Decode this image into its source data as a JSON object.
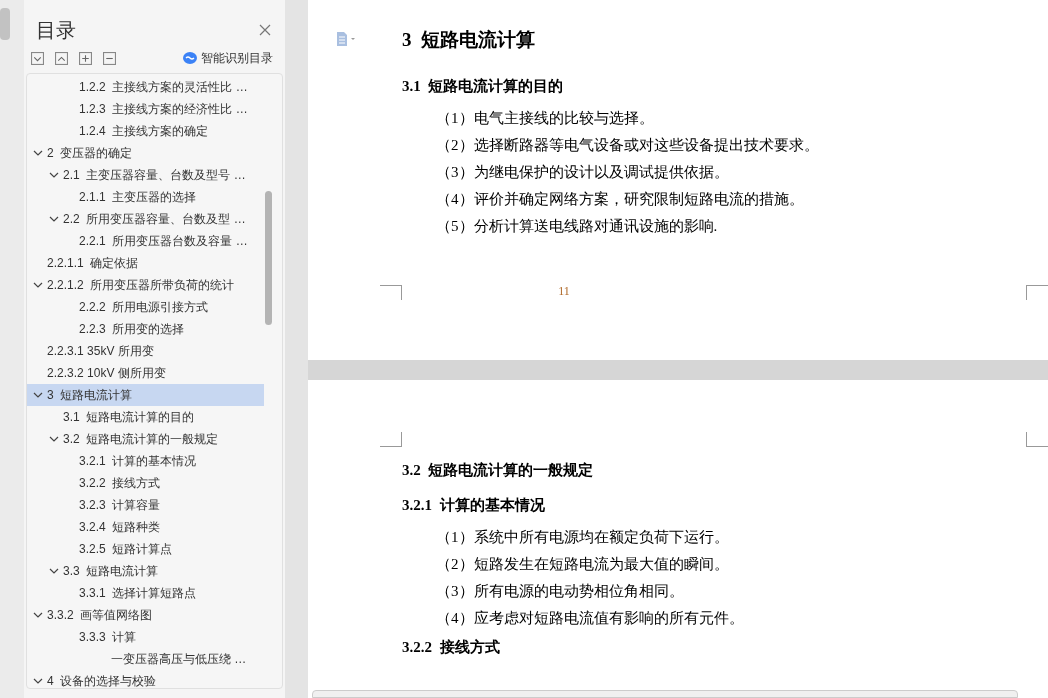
{
  "panel": {
    "title": "目录",
    "smart_button": "智能识别目录"
  },
  "toc": [
    {
      "children": [
        {
          "children": [
            {
              "label": "1.2.2  主接线方案的灵活性比 …",
              "selected": false
            },
            {
              "label": "1.2.3  主接线方案的经济性比 …",
              "selected": false
            },
            {
              "label": "1.2.4  主接线方案的确定",
              "selected": false
            }
          ]
        }
      ]
    },
    {
      "label": "2  变压器的确定",
      "expanded": true,
      "selected": false,
      "children": [
        {
          "label": "2.1  主变压器容量、台数及型号 …",
          "expanded": true,
          "selected": false,
          "children": [
            {
              "label": "2.1.1  主变压器的选择",
              "selected": false
            }
          ]
        },
        {
          "label": "2.2  所用变压器容量、台数及型 …",
          "expanded": true,
          "selected": false,
          "children": [
            {
              "label": "2.2.1  所用变压器台数及容量 …",
              "selected": false
            }
          ]
        }
      ]
    },
    {
      "label": "2.2.1.1  确定依据",
      "selected": false
    },
    {
      "label": "2.2.1.2  所用变压器所带负荷的统计",
      "expanded": true,
      "selected": false,
      "children": [
        {
          "children": [
            {
              "label": "2.2.2  所用电源引接方式",
              "selected": false
            },
            {
              "label": "2.2.3  所用变的选择",
              "selected": false
            }
          ]
        }
      ]
    },
    {
      "label": "2.2.3.1 35kV 所用变",
      "selected": false
    },
    {
      "label": "2.2.3.2 10kV 侧所用变",
      "selected": false
    },
    {
      "label": "3  短路电流计算",
      "expanded": true,
      "selected": true,
      "children": [
        {
          "label": "3.1  短路电流计算的目的",
          "selected": false
        },
        {
          "label": "3.2  短路电流计算的一般规定",
          "expanded": true,
          "selected": false,
          "children": [
            {
              "label": "3.2.1  计算的基本情况",
              "selected": false
            },
            {
              "label": "3.2.2  接线方式",
              "selected": false
            },
            {
              "label": "3.2.3  计算容量",
              "selected": false
            },
            {
              "label": "3.2.4  短路种类",
              "selected": false
            },
            {
              "label": "3.2.5  短路计算点",
              "selected": false
            }
          ]
        },
        {
          "label": "3.3  短路电流计算",
          "expanded": true,
          "selected": false,
          "children": [
            {
              "label": "3.3.1  选择计算短路点",
              "selected": false
            }
          ]
        }
      ]
    },
    {
      "label": "3.3.2  画等值网络图",
      "expanded": true,
      "selected": false,
      "children": [
        {
          "children": [
            {
              "label": "3.3.3  计算",
              "selected": false
            },
            {
              "children": [
                {
                  "children": [
                    {
                      "label": "一变压器高压与低压绕 …",
                      "selected": false
                    }
                  ]
                }
              ]
            }
          ]
        }
      ]
    },
    {
      "label": "4  设备的选择与校验",
      "expanded": true,
      "selected": false
    }
  ],
  "pages": [
    {
      "page_number": "11",
      "blocks": [
        {
          "kind": "h1",
          "text": "3  短路电流计算"
        },
        {
          "kind": "h2",
          "text": "3.1  短路电流计算的目的"
        },
        {
          "kind": "item",
          "text": "（1）电气主接线的比较与选择。"
        },
        {
          "kind": "item",
          "text": "（2）选择断路器等电气设备或对这些设备提出技术要求。"
        },
        {
          "kind": "item",
          "text": "（3）为继电保护的设计以及调试提供依据。"
        },
        {
          "kind": "item",
          "text": "（4）评价并确定网络方案，研究限制短路电流的措施。"
        },
        {
          "kind": "item",
          "text": "（5）分析计算送电线路对通讯设施的影响."
        }
      ]
    },
    {
      "blocks": [
        {
          "kind": "h2",
          "text": "3.2  短路电流计算的一般规定"
        },
        {
          "kind": "h3",
          "text": "3.2.1  计算的基本情况"
        },
        {
          "kind": "item",
          "text": "（1）系统中所有电源均在额定负荷下运行。"
        },
        {
          "kind": "item",
          "text": "（2）短路发生在短路电流为最大值的瞬间。"
        },
        {
          "kind": "item",
          "text": "（3）所有电源的电动势相位角相同。"
        },
        {
          "kind": "item",
          "text": "（4）应考虑对短路电流值有影响的所有元件。"
        },
        {
          "kind": "h3",
          "text": "3.2.2  接线方式"
        }
      ]
    }
  ]
}
